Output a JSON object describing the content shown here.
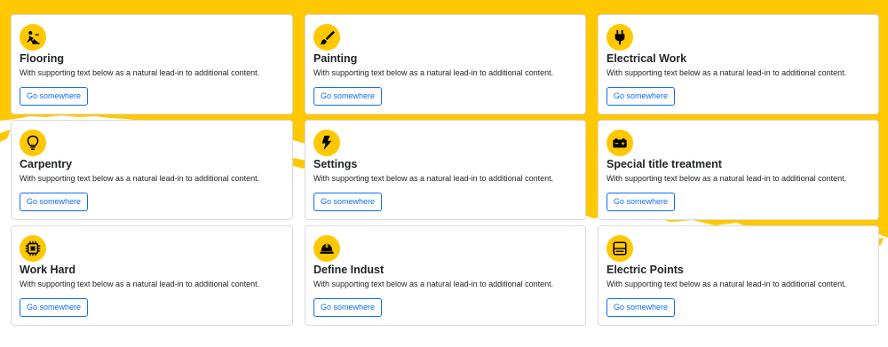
{
  "cards": [
    {
      "icon": "worker-icon",
      "title": "Flooring",
      "text": "With supporting text below as a natural lead-in to additional content.",
      "button": "Go somewhere"
    },
    {
      "icon": "paintbrush-icon",
      "title": "Painting",
      "text": "With supporting text below as a natural lead-in to additional content.",
      "button": "Go somewhere"
    },
    {
      "icon": "plug-icon",
      "title": "Electrical Work",
      "text": "With supporting text below as a natural lead-in to additional content.",
      "button": "Go somewhere"
    },
    {
      "icon": "lightbulb-icon",
      "title": "Carpentry",
      "text": "With supporting text below as a natural lead-in to additional content.",
      "button": "Go somewhere"
    },
    {
      "icon": "lightning-icon",
      "title": "Settings",
      "text": "With supporting text below as a natural lead-in to additional content.",
      "button": "Go somewhere"
    },
    {
      "icon": "battery-icon",
      "title": "Special title treatment",
      "text": "With supporting text below as a natural lead-in to additional content.",
      "button": "Go somewhere"
    },
    {
      "icon": "cpu-icon",
      "title": "Work Hard",
      "text": "With supporting text below as a natural lead-in to additional content.",
      "button": "Go somewhere"
    },
    {
      "icon": "hard-hat-icon",
      "title": "Define Indust",
      "text": "With supporting text below as a natural lead-in to additional content.",
      "button": "Go somewhere"
    },
    {
      "icon": "panel-icon",
      "title": "Electric Points",
      "text": "With supporting text below as a natural lead-in to additional content.",
      "button": "Go somewhere"
    }
  ],
  "colors": {
    "accent": "#ffc800",
    "button": "#0d6efd",
    "text": "#212529"
  }
}
